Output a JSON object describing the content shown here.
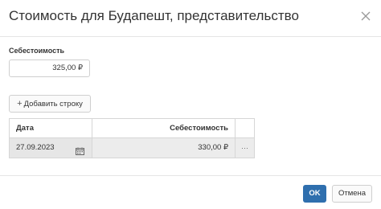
{
  "dialog": {
    "title": "Стоимость для Будапешт, представительство"
  },
  "form": {
    "cost_label": "Себестоимость",
    "cost_value": "325,00 ₽",
    "add_row_label": "Добавить строку"
  },
  "grid": {
    "columns": [
      "Дата",
      "Себестоимость"
    ],
    "rows": [
      {
        "date": "27.09.2023",
        "cost": "330,00 ₽",
        "menu": "···"
      }
    ]
  },
  "footer": {
    "ok_label": "OK",
    "cancel_label": "Отмена"
  },
  "colors": {
    "primary": "#2f6fae",
    "border": "#d6d6d6",
    "row_bg": "#ececec"
  }
}
